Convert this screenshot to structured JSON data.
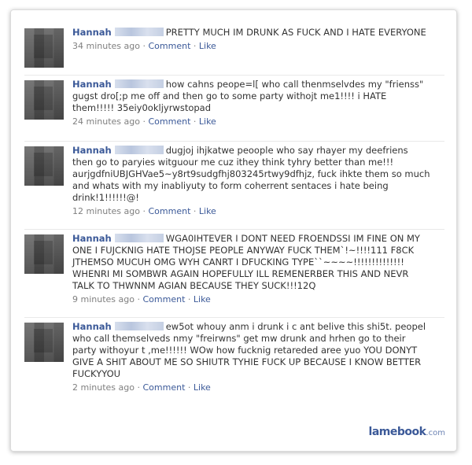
{
  "posts": [
    {
      "author": "Hannah",
      "text": "PRETTY MUCH IM DRUNK AS FUCK AND I HATE EVERYONE",
      "time": "34 minutes ago",
      "comment_label": "Comment",
      "like_label": "Like"
    },
    {
      "author": "Hannah",
      "text": "how cahns peope=l[ who call thenmselvdes my \"frienss\" gugst dro[;p me off and then go to some party withojt me1!!!! i HATE them!!!!! 35eiy0okljyrwstopad",
      "time": "24 minutes ago",
      "comment_label": "Comment",
      "like_label": "Like"
    },
    {
      "author": "Hannah",
      "text": "dugjoj ihjkatwe peoople who say rhayer my deefriens then go to paryies witguour me cuz ithey think tyhry better than me!!! aurjgdfniUBJGHVae5~y8rt9sudgfhj803245rtwy9dfhjz, fuck ihkte them so much and whats with my inabliyuty to form coherrent sentaces i hate being drink!1!!!!!!@!",
      "time": "12 minutes ago",
      "comment_label": "Comment",
      "like_label": "Like"
    },
    {
      "author": "Hannah",
      "text": "WGA0IHTEVER I DONT NEED FROENDSSI IM FINE ON MY ONE I FUJCKNIG HATE THOJSE PEOPLE ANYWAY FUCK THEM`!~!!!!111 F8CK JTHEMSO MUCUH OMG WYH CANRT I DFUCKING TYPE``~~~~!!!!!!!!!!!!!! WHENRI MI SOMBWR AGAIN HOPEFULLY ILL REMENERBER THIS AND NEVR TALK TO THWNNM AGIAN BECAUSE THEY SUCK!!!12Q",
      "time": "9 minutes ago",
      "comment_label": "Comment",
      "like_label": "Like"
    },
    {
      "author": "Hannah",
      "text": "ew5ot whouy anm i drunk i c ant belive this shi5t. peopel who call themselveds nmy \"freirwns\" get mw drunk and hrhen go to their party withoyur t ,me!!!!!! WOw how fucknig retareded aree yuo YOU DONYT GIVE A SHIT ABOUT ME SO SHIUTR TYHIE FUCK UP BECAUSE I KNOW BETTER FUCKYYOU",
      "time": "2 minutes ago",
      "comment_label": "Comment",
      "like_label": "Like"
    }
  ],
  "meta_separator": "·",
  "watermark": {
    "brand": "lamebook",
    "suffix": ".com"
  },
  "colors": {
    "link": "#3b5998",
    "meta": "#808080",
    "text": "#333333"
  }
}
